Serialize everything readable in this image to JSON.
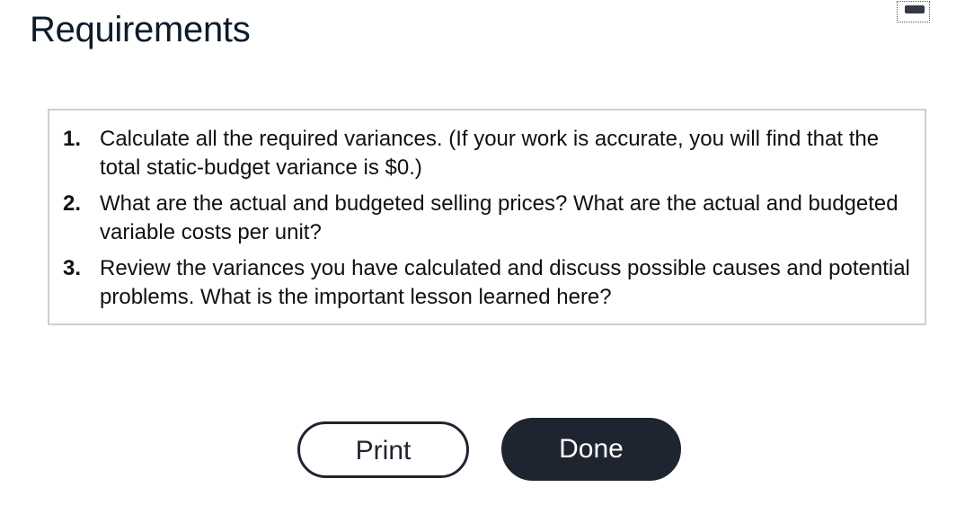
{
  "dialog": {
    "title": "Requirements",
    "minimize_icon": "minimize-icon"
  },
  "requirements": [
    {
      "number": "1.",
      "text": "Calculate all the required variances. (If your work is accurate, you will find that the total static-budget variance is $0.)"
    },
    {
      "number": "2.",
      "text": "What are the actual and budgeted selling prices? What are the actual and budgeted variable costs per unit?"
    },
    {
      "number": "3.",
      "text": "Review the variances you have calculated and discuss possible causes and potential problems. What is the important lesson learned here?"
    }
  ],
  "buttons": {
    "print_label": "Print",
    "done_label": "Done"
  },
  "colors": {
    "title": "#0d1b2a",
    "button_dark": "#1f2530",
    "panel_border": "#cfcfcf"
  }
}
